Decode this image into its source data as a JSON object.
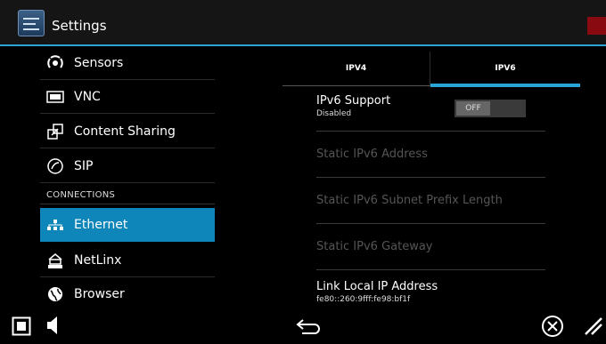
{
  "header": {
    "title": "Settings",
    "app_icon": "settings-sliders-icon",
    "accent_color": "#2aa3d6"
  },
  "sidebar": {
    "items": [
      {
        "label": "Sensors",
        "icon": "sensors-icon"
      },
      {
        "label": "VNC",
        "icon": "vnc-icon"
      },
      {
        "label": "Content Sharing",
        "icon": "content-sharing-icon"
      },
      {
        "label": "SIP",
        "icon": "sip-icon"
      }
    ],
    "section_header": "CONNECTIONS",
    "connections": [
      {
        "label": "Ethernet",
        "icon": "ethernet-icon",
        "active": true
      },
      {
        "label": "NetLinx",
        "icon": "netlinx-icon"
      },
      {
        "label": "Browser",
        "icon": "browser-icon"
      }
    ],
    "active_color": "#0f86b9"
  },
  "tabs": [
    {
      "label": "IPV4",
      "selected": false
    },
    {
      "label": "IPV6",
      "selected": true
    }
  ],
  "settings": {
    "ipv6_support": {
      "title": "IPv6 Support",
      "subtitle": "Disabled",
      "toggle_label": "OFF"
    },
    "static_address": {
      "title": "Static IPv6 Address"
    },
    "subnet_prefix": {
      "title": "Static IPv6 Subnet Prefix Length"
    },
    "gateway": {
      "title": "Static IPv6 Gateway"
    },
    "link_local": {
      "title": "Link Local IP Address",
      "value": "fe80::260:9fff:fe98:bf1f"
    }
  },
  "bottom_bar": {
    "icons": [
      "stop-square-icon",
      "volume-icon",
      "back-arrow-icon",
      "close-circle-icon",
      "resize-grip-icon"
    ]
  }
}
